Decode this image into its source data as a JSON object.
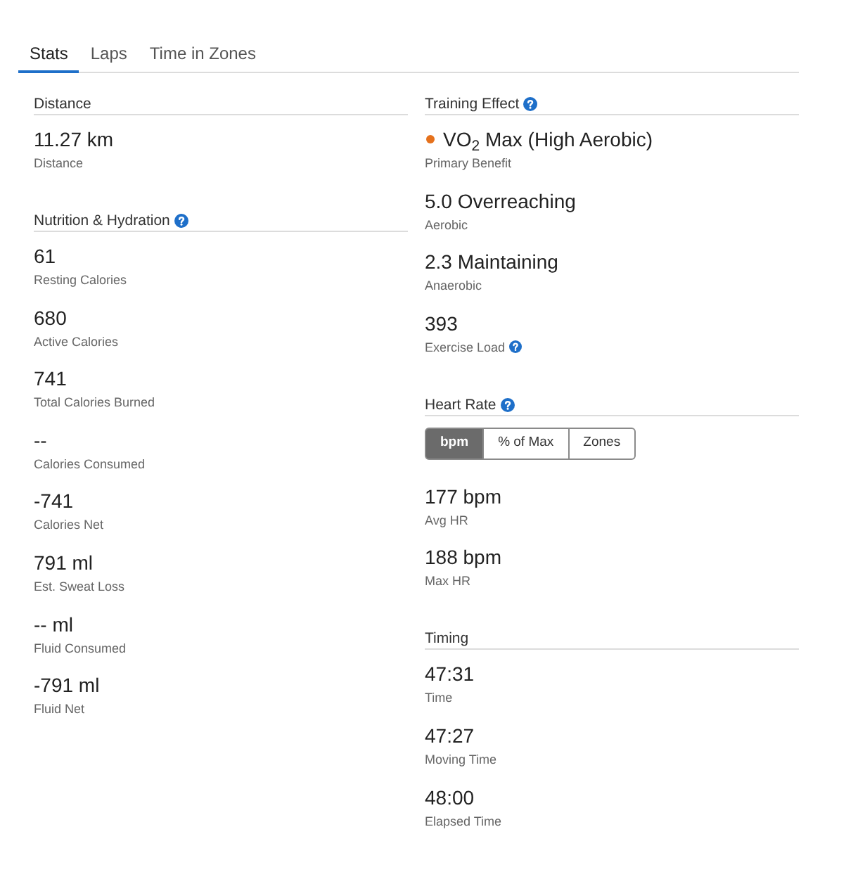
{
  "tabs": [
    {
      "label": "Stats",
      "selected": true
    },
    {
      "label": "Laps",
      "selected": false
    },
    {
      "label": "Time in Zones",
      "selected": false
    }
  ],
  "columns": [
    {
      "sections": [
        {
          "title": "Distance",
          "help": false,
          "stats": [
            {
              "value": "11.27 km",
              "label": "Distance"
            }
          ]
        },
        {
          "title": "Nutrition & Hydration",
          "help": true,
          "stats": [
            {
              "value": "61",
              "label": "Resting Calories"
            },
            {
              "value": "680",
              "label": "Active Calories"
            },
            {
              "value": "741",
              "label": "Total Calories Burned"
            },
            {
              "value": "--",
              "label": "Calories Consumed"
            },
            {
              "value": "-741",
              "label": "Calories Net"
            },
            {
              "value": "791 ml",
              "label": "Est. Sweat Loss"
            },
            {
              "value": "-- ml",
              "label": "Fluid Consumed"
            },
            {
              "value": "-791 ml",
              "label": "Fluid Net"
            }
          ]
        }
      ]
    },
    {
      "sections": [
        {
          "title": "Training Effect",
          "help": true,
          "stats": [
            {
              "value": "VO$_{2}$ Max (High Aerobic)",
              "label": "Primary Benefit",
              "color": "#e5711c"
            },
            {
              "value": "5.0 Overreaching",
              "label": "Aerobic"
            },
            {
              "value": "2.3 Maintaining",
              "label": "Anaerobic"
            },
            {
              "value": "393",
              "label": "Exercise Load",
              "help": true
            }
          ]
        },
        {
          "title": "Heart Rate",
          "help": true,
          "toggle": [
            {
              "label": "bpm",
              "selected": true
            },
            {
              "label": "% of Max",
              "selected": false
            },
            {
              "label": "Zones",
              "selected": false
            }
          ],
          "stats": [
            {
              "value": "177 bpm",
              "label": "Avg HR"
            },
            {
              "value": "188 bpm",
              "label": "Max HR"
            }
          ]
        },
        {
          "title": "Timing",
          "help": false,
          "stats": [
            {
              "value": "47:31",
              "label": "Time"
            },
            {
              "value": "47:27",
              "label": "Moving Time"
            },
            {
              "value": "48:00",
              "label": "Elapsed Time"
            }
          ]
        }
      ]
    }
  ]
}
